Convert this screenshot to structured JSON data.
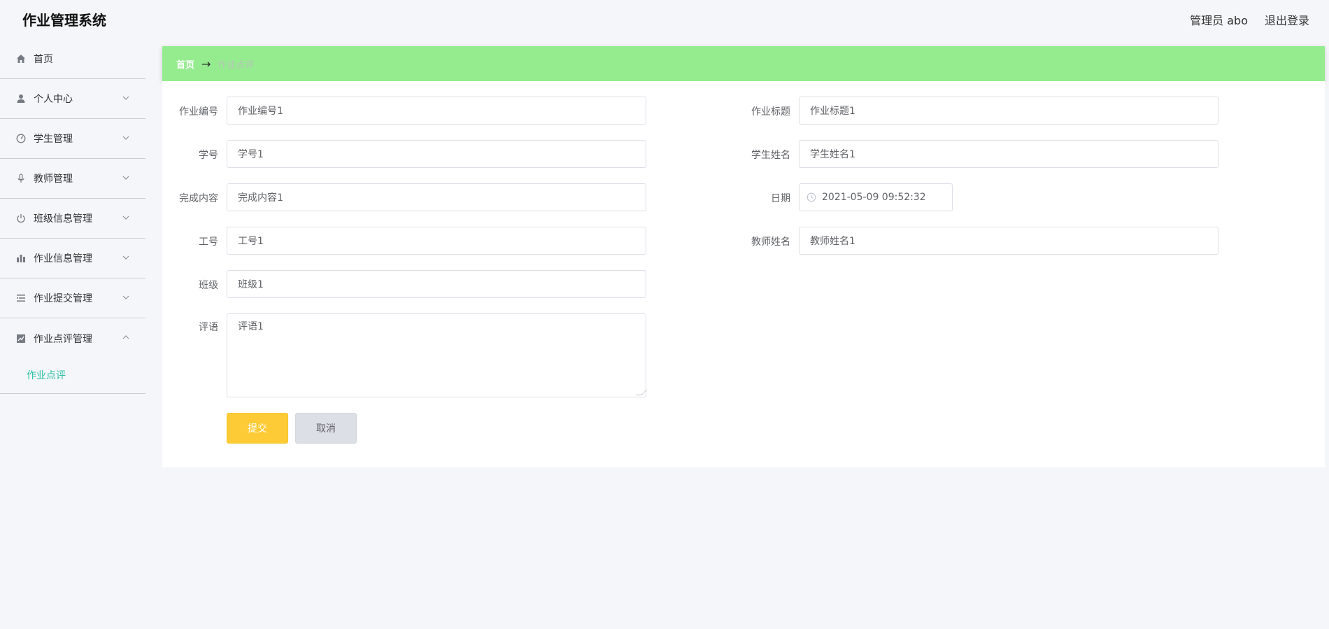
{
  "app": {
    "title": "作业管理系统"
  },
  "header": {
    "user": "管理员 abo",
    "logout": "退出登录"
  },
  "sidebar": {
    "items": [
      {
        "label": "首页",
        "icon": "home-icon"
      },
      {
        "label": "个人中心",
        "icon": "user-icon"
      },
      {
        "label": "学生管理",
        "icon": "dashboard-icon"
      },
      {
        "label": "教师管理",
        "icon": "microphone-icon"
      },
      {
        "label": "班级信息管理",
        "icon": "power-icon"
      },
      {
        "label": "作业信息管理",
        "icon": "bar-chart-icon"
      },
      {
        "label": "作业提交管理",
        "icon": "list-icon"
      },
      {
        "label": "作业点评管理",
        "icon": "line-chart-icon"
      }
    ],
    "submenu": {
      "label": "作业点评"
    }
  },
  "breadcrumb": {
    "home": "首页",
    "arrow": "→",
    "current": "作业点评"
  },
  "form": {
    "homework_no": {
      "label": "作业编号",
      "value": "作业编号1"
    },
    "homework_title": {
      "label": "作业标题",
      "value": "作业标题1"
    },
    "student_no": {
      "label": "学号",
      "value": "学号1"
    },
    "student_name": {
      "label": "学生姓名",
      "value": "学生姓名1"
    },
    "content": {
      "label": "完成内容",
      "value": "完成内容1"
    },
    "date": {
      "label": "日期",
      "value": "2021-05-09 09:52:32"
    },
    "staff_no": {
      "label": "工号",
      "value": "工号1"
    },
    "teacher_name": {
      "label": "教师姓名",
      "value": "教师姓名1"
    },
    "class": {
      "label": "班级",
      "value": "班级1"
    },
    "comment": {
      "label": "评语",
      "value": "评语1"
    },
    "submit": "提交",
    "cancel": "取消"
  },
  "colors": {
    "breadcrumb_bg": "#94ec8f",
    "submit_bg": "#fccb35",
    "active_submenu": "#2bbfa3"
  }
}
